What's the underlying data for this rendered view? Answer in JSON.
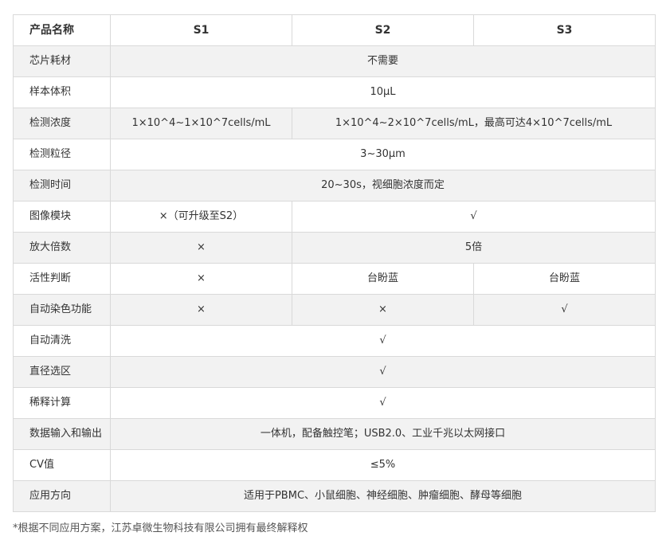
{
  "header": {
    "label": "产品名称",
    "s1": "S1",
    "s2": "S2",
    "s3": "S3"
  },
  "rows": {
    "chip": {
      "label": "芯片耗材",
      "value": "不需要"
    },
    "volume": {
      "label": "样本体积",
      "value": "10μL"
    },
    "concentration": {
      "label": "检测浓度",
      "s1": "1×10^4~1×10^7cells/mL",
      "s23": "1×10^4~2×10^7cells/mL，最高可达4×10^7cells/mL"
    },
    "size": {
      "label": "检测粒径",
      "value": "3~30μm"
    },
    "time": {
      "label": "检测时间",
      "value": "20~30s，视细胞浓度而定"
    },
    "imaging": {
      "label": "图像模块",
      "s1": "×（可升级至S2）",
      "s23": "√"
    },
    "magnification": {
      "label": "放大倍数",
      "s1": "×",
      "s23": "5倍"
    },
    "viability": {
      "label": "活性判断",
      "s1": "×",
      "s2": "台盼蓝",
      "s3": "台盼蓝"
    },
    "staining": {
      "label": "自动染色功能",
      "s1": "×",
      "s2": "×",
      "s3": "√"
    },
    "cleaning": {
      "label": "自动清洗",
      "value": "√"
    },
    "diameter": {
      "label": "直径选区",
      "value": "√"
    },
    "dilution": {
      "label": "稀释计算",
      "value": "√"
    },
    "io": {
      "label": "数据输入和输出",
      "value": "一体机，配备触控笔；USB2.0、工业千兆以太网接口"
    },
    "cv": {
      "label": "CV值",
      "value": "≤5%"
    },
    "application": {
      "label": "应用方向",
      "value": "适用于PBMC、小鼠细胞、神经细胞、肿瘤细胞、酵母等细胞"
    }
  },
  "footnote": "*根据不同应用方案，江苏卓微生物科技有限公司拥有最终解释权"
}
